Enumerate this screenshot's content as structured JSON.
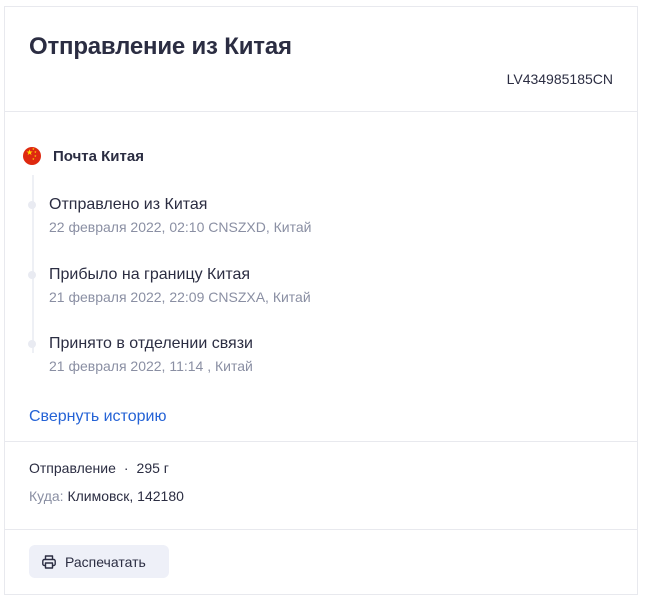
{
  "header": {
    "title": "Отправление из Китая",
    "track_number": "LV434985185CN"
  },
  "timeline": {
    "carrier": {
      "name": "Почта Китая",
      "flag_icon": "china-flag-icon"
    },
    "events": [
      {
        "title": "Отправлено из Китая",
        "meta": "22 февраля 2022, 02:10 CNSZXD, Китай"
      },
      {
        "title": "Прибыло на границу Китая",
        "meta": "21 февраля 2022, 22:09 CNSZXA, Китай"
      },
      {
        "title": "Принято в отделении связи",
        "meta": "21 февраля 2022, 11:14 , Китай"
      }
    ],
    "collapse_label": "Свернуть историю"
  },
  "details": {
    "type_label": "Отправление",
    "separator": "·",
    "weight": "295 г",
    "destination_label": "Куда:",
    "destination_value": "Климовск, 142180"
  },
  "footer": {
    "print_label": "Распечатать",
    "print_icon": "printer-icon"
  },
  "colors": {
    "text": "#2b2d42",
    "muted": "#8a8fa3",
    "link": "#2563d6",
    "flag_red": "#de2910",
    "flag_star": "#ffde00",
    "button_bg": "#eef0f8"
  }
}
